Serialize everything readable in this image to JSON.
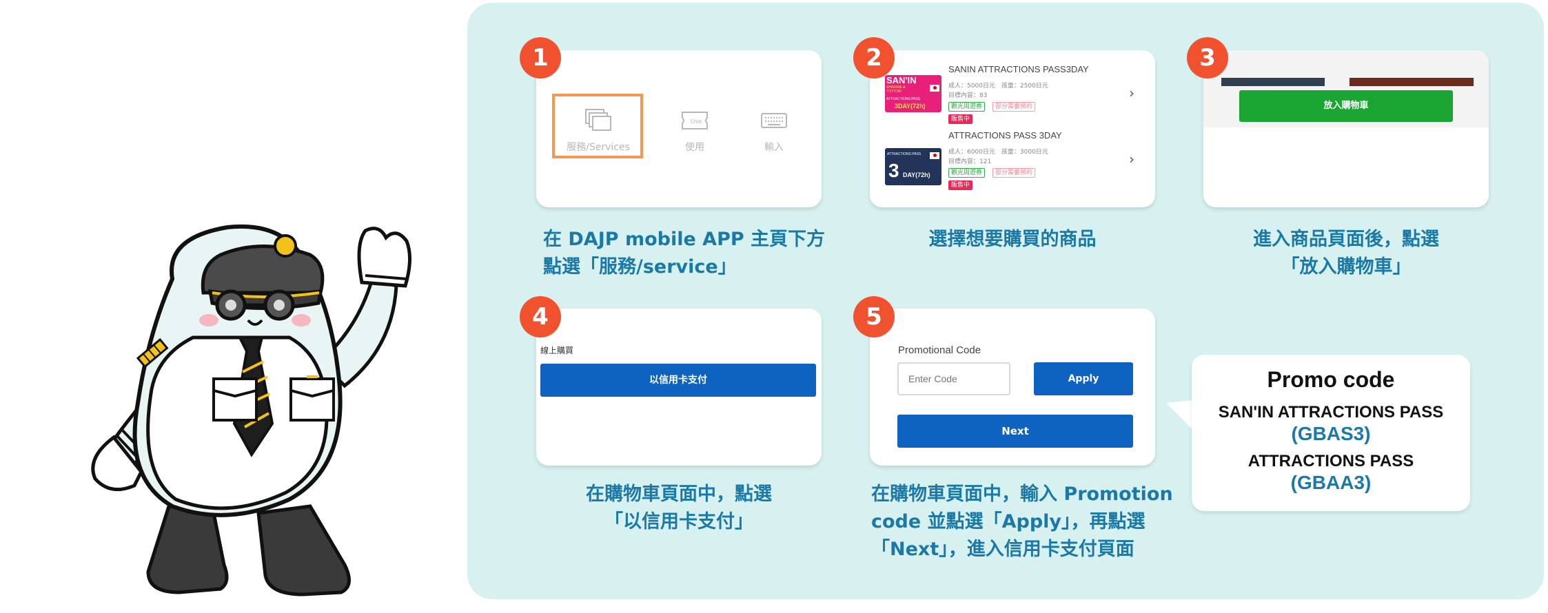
{
  "steps": [
    {
      "number": "1",
      "caption": "在 DAJP mobile APP 主頁下方\n點選「服務/service」",
      "items": [
        {
          "label": "服務/Services",
          "icon": "services-icon"
        },
        {
          "label": "使用",
          "icon": "ticket-use-icon",
          "icon_text": "Use"
        },
        {
          "label": "輸入",
          "icon": "keyboard-icon"
        }
      ]
    },
    {
      "number": "2",
      "caption": "選擇想要購買的商品",
      "products": [
        {
          "title": "SANIN ATTRACTIONS PASS3DAY",
          "price_line": "成人：5000日元　孩童：2500日元",
          "count_line": "目標內容：83",
          "tag_green": "觀光周遊券",
          "tag_pink": "部分需要預約",
          "tag_red": "販售中",
          "thumb_text": "SAN'IN",
          "thumb_sub": "SHIMANE & TOTTORI",
          "thumb_label": "ATTRACTIONS PASS",
          "thumb_days": "3DAY(72h)"
        },
        {
          "title": "ATTRACTIONS PASS 3DAY",
          "price_line": "成人：6000日元　孩童：3000日元",
          "count_line": "目標內容：121",
          "tag_green": "觀光周遊券",
          "tag_pink": "部分需要預約",
          "tag_red": "販售中",
          "thumb_label": "ATTRACTIONS PASS",
          "thumb_num": "3",
          "thumb_days": "DAY(72h)"
        }
      ],
      "chevron": "›"
    },
    {
      "number": "3",
      "caption": "進入商品頁面後，點選\n「放入購物車」",
      "button": "放入購物車"
    },
    {
      "number": "4",
      "caption": "在購物車頁面中，點選\n「以信用卡支付」",
      "section_label": "線上購買",
      "button": "以信用卡支付"
    },
    {
      "number": "5",
      "caption": "在購物車頁面中，輸入 Promotion\ncode 並點選「Apply」，再點選\n「Next」，進入信用卡支付頁面",
      "field_label": "Promotional Code",
      "field_placeholder": "Enter Code",
      "apply": "Apply",
      "next": "Next"
    }
  ],
  "promo": {
    "title": "Promo code",
    "pass1": "SAN'IN ATTRACTIONS PASS",
    "code1": "(GBAS3)",
    "pass2": "ATTRACTIONS PASS",
    "code2": "(GBAA3)"
  },
  "colors": {
    "panel": "#d7f1f0",
    "badge": "#f05230",
    "caption": "#1b79a8",
    "blue_button": "#0e62c0",
    "green_button": "#1aa431",
    "promo_code": "#1b79a8"
  }
}
